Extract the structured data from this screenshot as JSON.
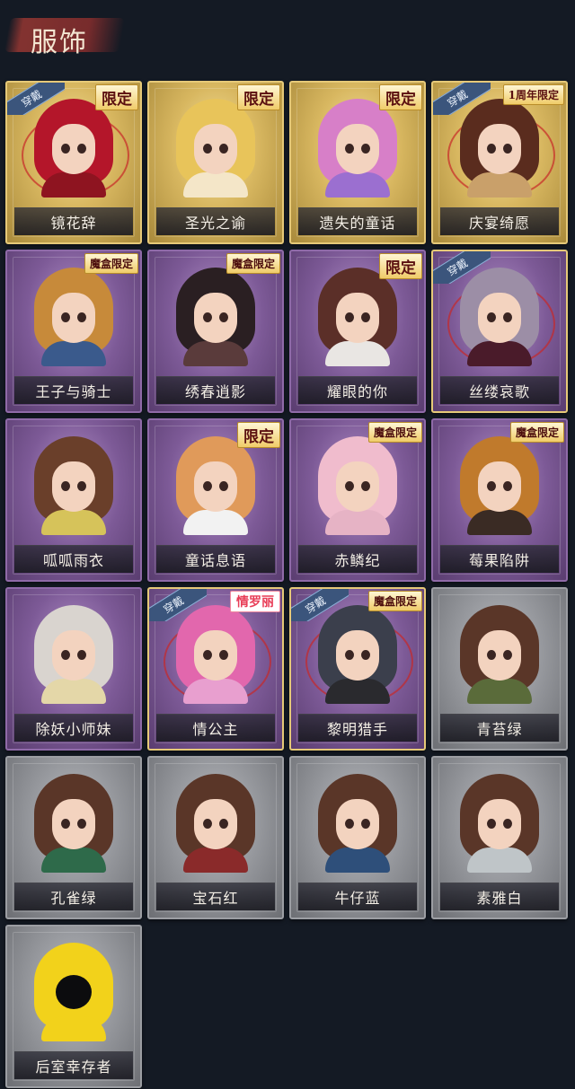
{
  "header": {
    "title": "服饰"
  },
  "tags": {
    "limited": "限定",
    "box_limited": "魔盒限定",
    "anniversary_limited": "1周年限定",
    "valentine": "情罗丽",
    "worn": "穿戴"
  },
  "costumes": [
    {
      "name": "镜花辞",
      "frame": "gold",
      "tag": "限定",
      "tag_type": "limited",
      "worn": true,
      "hair": "#b4162a",
      "outfit": "#8e1420"
    },
    {
      "name": "圣光之谕",
      "frame": "gold",
      "tag": "限定",
      "tag_type": "limited",
      "worn": false,
      "hair": "#e8c45a",
      "outfit": "#f4e6c8"
    },
    {
      "name": "遗失的童话",
      "frame": "gold",
      "tag": "限定",
      "tag_type": "limited",
      "worn": false,
      "hair": "#d77fc8",
      "outfit": "#9b6fd0"
    },
    {
      "name": "庆宴绮愿",
      "frame": "gold",
      "tag": "1周年限定",
      "tag_type": "anniv",
      "worn": true,
      "hair": "#5a2c1e",
      "outfit": "#c9a06a"
    },
    {
      "name": "王子与骑士",
      "frame": "purple",
      "tag": "魔盒限定",
      "tag_type": "box",
      "worn": false,
      "hair": "#c78a3a",
      "outfit": "#3a5a8c"
    },
    {
      "name": "绣春逍影",
      "frame": "purple",
      "tag": "魔盒限定",
      "tag_type": "box",
      "worn": false,
      "hair": "#2a1f22",
      "outfit": "#5a3b3b"
    },
    {
      "name": "耀眼的你",
      "frame": "purple",
      "tag": "限定",
      "tag_type": "limited",
      "worn": false,
      "hair": "#5b2f28",
      "outfit": "#e9e6e3"
    },
    {
      "name": "丝缕哀歌",
      "frame": "purple",
      "tag": "",
      "tag_type": "none",
      "worn": true,
      "hair": "#9c8ea6",
      "outfit": "#4a1b2a"
    },
    {
      "name": "呱呱雨衣",
      "frame": "purple",
      "tag": "",
      "tag_type": "none",
      "worn": false,
      "hair": "#6a3f2a",
      "outfit": "#d6c35a"
    },
    {
      "name": "童话息语",
      "frame": "purple",
      "tag": "限定",
      "tag_type": "limited",
      "worn": false,
      "hair": "#e09a5a",
      "outfit": "#f2f2f2"
    },
    {
      "name": "赤鳞纪",
      "frame": "purple",
      "tag": "魔盒限定",
      "tag_type": "box",
      "worn": false,
      "hair": "#f0bccd",
      "outfit": "#e6b3c5"
    },
    {
      "name": "莓果陷阱",
      "frame": "purple",
      "tag": "魔盒限定",
      "tag_type": "box",
      "worn": false,
      "hair": "#c07a2c",
      "outfit": "#3a2b24"
    },
    {
      "name": "除妖小师妹",
      "frame": "purple",
      "tag": "",
      "tag_type": "none",
      "worn": false,
      "hair": "#d9d4cf",
      "outfit": "#e4d7a8"
    },
    {
      "name": "情公主",
      "frame": "purple",
      "tag": "情罗丽",
      "tag_type": "valentine",
      "worn": true,
      "hair": "#e267ad",
      "outfit": "#e89fcf"
    },
    {
      "name": "黎明猎手",
      "frame": "purple",
      "tag": "魔盒限定",
      "tag_type": "box",
      "worn": true,
      "hair": "#3b3f4c",
      "outfit": "#2a2a2e"
    },
    {
      "name": "青苔绿",
      "frame": "grey",
      "tag": "",
      "tag_type": "none",
      "worn": false,
      "hair": "#5a3628",
      "outfit": "#5a6b3a"
    },
    {
      "name": "孔雀绿",
      "frame": "grey",
      "tag": "",
      "tag_type": "none",
      "worn": false,
      "hair": "#5a3628",
      "outfit": "#2e6a4a"
    },
    {
      "name": "宝石红",
      "frame": "grey",
      "tag": "",
      "tag_type": "none",
      "worn": false,
      "hair": "#5a3628",
      "outfit": "#8a2a2a"
    },
    {
      "name": "牛仔蓝",
      "frame": "grey",
      "tag": "",
      "tag_type": "none",
      "worn": false,
      "hair": "#5a3628",
      "outfit": "#2e4f7a"
    },
    {
      "name": "素雅白",
      "frame": "grey",
      "tag": "",
      "tag_type": "none",
      "worn": false,
      "hair": "#5a3628",
      "outfit": "#bfc5c8"
    },
    {
      "name": "后室幸存者",
      "frame": "grey",
      "tag": "",
      "tag_type": "none",
      "worn": false,
      "hair": "#f2d21b",
      "outfit": "#f2d21b",
      "masked": true
    }
  ]
}
